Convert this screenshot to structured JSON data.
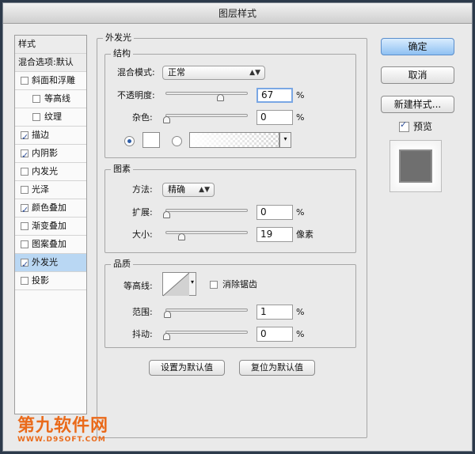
{
  "window": {
    "title": "图层样式"
  },
  "style_list": {
    "header": "样式",
    "blend_default": "混合选项:默认",
    "items": [
      {
        "label": "斜面和浮雕",
        "checked": false
      },
      {
        "label": "等高线",
        "checked": false
      },
      {
        "label": "纹理",
        "checked": false
      },
      {
        "label": "描边",
        "checked": true
      },
      {
        "label": "内阴影",
        "checked": true
      },
      {
        "label": "内发光",
        "checked": false
      },
      {
        "label": "光泽",
        "checked": false
      },
      {
        "label": "颜色叠加",
        "checked": true
      },
      {
        "label": "渐变叠加",
        "checked": false
      },
      {
        "label": "图案叠加",
        "checked": false
      },
      {
        "label": "外发光",
        "checked": true,
        "selected": true
      },
      {
        "label": "投影",
        "checked": false
      }
    ]
  },
  "panel": {
    "title": "外发光",
    "structure": {
      "title": "结构",
      "blend_mode_label": "混合模式:",
      "blend_mode_value": "正常",
      "opacity_label": "不透明度:",
      "opacity_value": "67",
      "opacity_unit": "%",
      "opacity_level": 67,
      "noise_label": "杂色:",
      "noise_value": "0",
      "noise_unit": "%",
      "noise_level": 0,
      "glow_color": "#ffffff",
      "gradient_arrow": "▾"
    },
    "elements": {
      "title": "图素",
      "method_label": "方法:",
      "method_value": "精确",
      "spread_label": "扩展:",
      "spread_value": "0",
      "spread_unit": "%",
      "spread_level": 0,
      "size_label": "大小:",
      "size_value": "19",
      "size_unit": "像素",
      "size_level": 19
    },
    "quality": {
      "title": "品质",
      "contour_label": "等高线:",
      "contour_arrow": "▾",
      "antialias_label": "消除锯齿",
      "antialias_checked": false,
      "range_label": "范围:",
      "range_value": "1",
      "range_unit": "%",
      "range_level": 1,
      "jitter_label": "抖动:",
      "jitter_value": "0",
      "jitter_unit": "%",
      "jitter_level": 0
    },
    "make_default_label": "设置为默认值",
    "reset_default_label": "复位为默认值"
  },
  "buttons": {
    "ok": "确定",
    "cancel": "取消",
    "new_style": "新建样式...",
    "preview_label": "预览",
    "preview_checked": true
  },
  "watermark": {
    "line1": "第九软件网",
    "line2": "WWW.D9SOFT.COM"
  },
  "colors": {
    "accent": "#8fc1f2",
    "watermark": "#ea6a1a",
    "selected_row": "#b9d7f3"
  }
}
